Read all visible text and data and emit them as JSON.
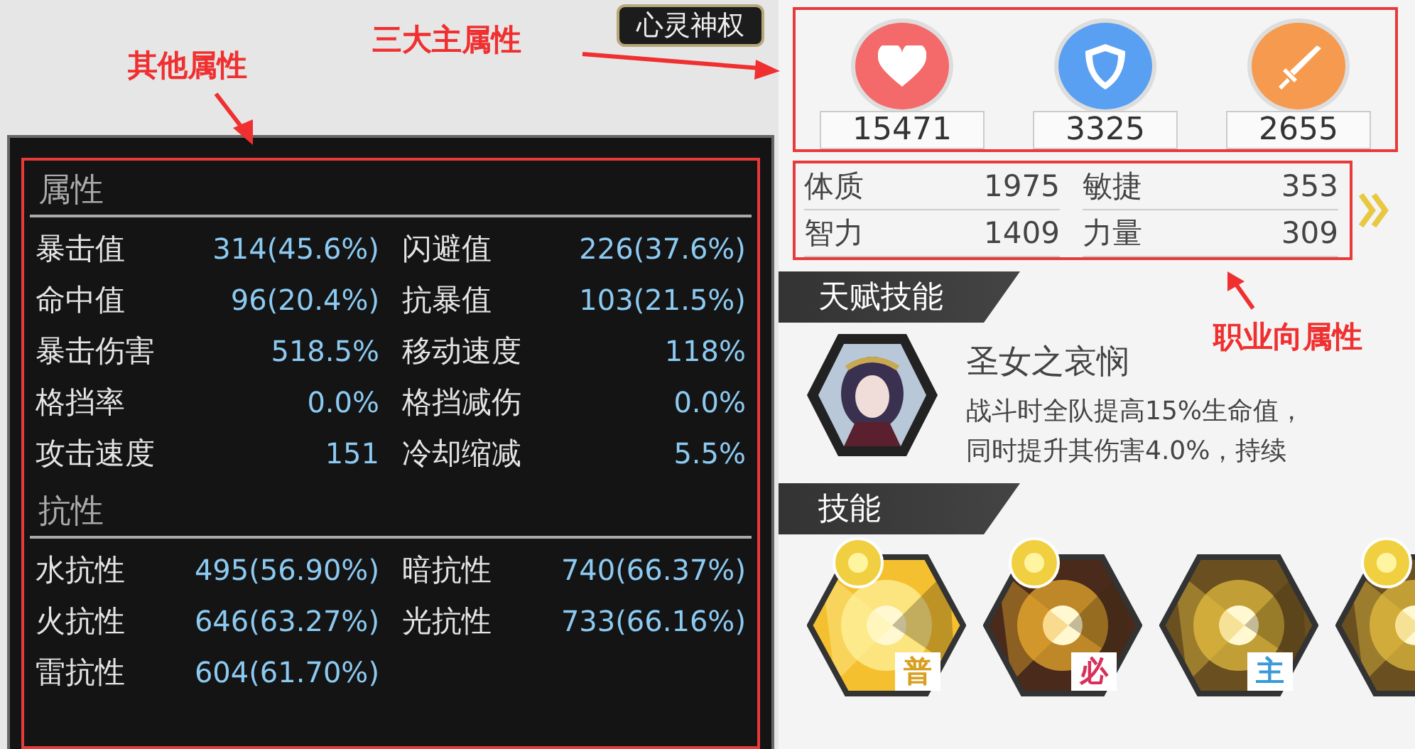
{
  "emblem": {
    "label": "心灵神权"
  },
  "annotations": [
    {
      "text": "其他属性"
    },
    {
      "text": "三大主属性"
    },
    {
      "text": "职业向属性"
    }
  ],
  "other_stats": {
    "sections": [
      {
        "title": "属性",
        "items": [
          {
            "label": "暴击值",
            "value": "314(45.6%)"
          },
          {
            "label": "闪避值",
            "value": "226(37.6%)"
          },
          {
            "label": "命中值",
            "value": "96(20.4%)"
          },
          {
            "label": "抗暴值",
            "value": "103(21.5%)"
          },
          {
            "label": "暴击伤害",
            "value": "518.5%"
          },
          {
            "label": "移动速度",
            "value": "118%"
          },
          {
            "label": "格挡率",
            "value": "0.0%"
          },
          {
            "label": "格挡减伤",
            "value": "0.0%"
          },
          {
            "label": "攻击速度",
            "value": "151"
          },
          {
            "label": "冷却缩减",
            "value": "5.5%"
          }
        ]
      },
      {
        "title": "抗性",
        "items": [
          {
            "label": "水抗性",
            "value": "495(56.90%)"
          },
          {
            "label": "暗抗性",
            "value": "740(66.37%)"
          },
          {
            "label": "火抗性",
            "value": "646(63.27%)"
          },
          {
            "label": "光抗性",
            "value": "733(66.16%)"
          },
          {
            "label": "雷抗性",
            "value": "604(61.70%)"
          }
        ]
      }
    ]
  },
  "main_stats": [
    {
      "kind": "hp",
      "value": "15471"
    },
    {
      "kind": "defense",
      "value": "3325"
    },
    {
      "kind": "attack",
      "value": "2655"
    }
  ],
  "class_stats": [
    {
      "label": "体质",
      "value": "1975"
    },
    {
      "label": "敏捷",
      "value": "353"
    },
    {
      "label": "智力",
      "value": "1409"
    },
    {
      "label": "力量",
      "value": "309"
    }
  ],
  "talent": {
    "header": "天赋技能",
    "name": "圣女之哀悯",
    "lines": [
      "战斗时全队提高15%生命值，",
      "同时提升其伤害4.0%，持续"
    ]
  },
  "skills": {
    "header": "技能",
    "items": [
      {
        "kind": "normal",
        "tag": "普",
        "star": true
      },
      {
        "kind": "ultimate",
        "tag": "必",
        "star": true
      },
      {
        "kind": "active",
        "tag": "主",
        "star": false
      },
      {
        "kind": "active",
        "star": true
      }
    ]
  }
}
